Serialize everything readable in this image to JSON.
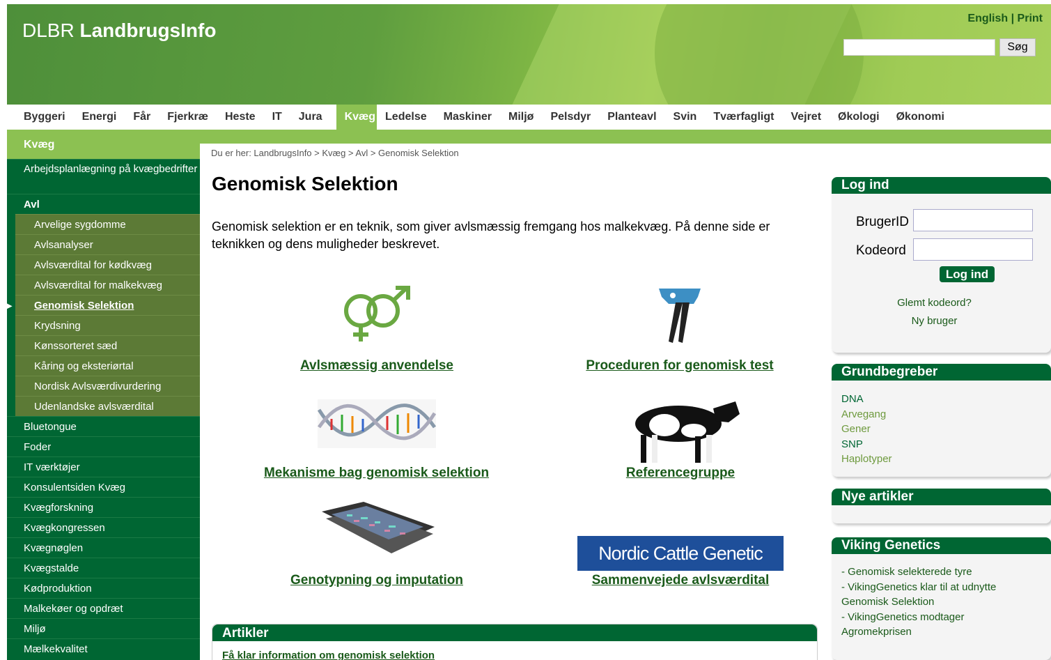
{
  "header": {
    "logo_light": "DLBR ",
    "logo_bold": "LandbrugsInfo",
    "link_english": "English",
    "link_separator": " | ",
    "link_print": "Print",
    "search_placeholder": "",
    "search_button": "Søg"
  },
  "nav": {
    "items": [
      "Byggeri",
      "Energi",
      "Får",
      "Fjerkræ",
      "Heste",
      "IT",
      "Jura",
      "Kvæg",
      "Ledelse",
      "Maskiner",
      "Miljø",
      "Pelsdyr",
      "Planteavl",
      "Svin",
      "Tværfagligt",
      "Vejret",
      "Økologi",
      "Økonomi"
    ],
    "active": "Kvæg"
  },
  "sidebar": {
    "heading": "Kvæg",
    "item_arbejd": "Arbejdsplanlægning på kvægbedrifter",
    "item_avl": "Avl",
    "sub": [
      "Arvelige sygdomme",
      "Avlsanalyser",
      "Avlsværdital for kødkvæg",
      "Avlsværdital for malkekvæg",
      "Genomisk Selektion",
      "Krydsning",
      "Kønssorteret sæd",
      "Kåring og eksteriørtal",
      "Nordisk Avlsværdivurdering",
      "Udenlandske avlsværdital"
    ],
    "items": [
      "Bluetongue",
      "Foder",
      "IT værktøjer",
      "Konsulentsiden Kvæg",
      "Kvægforskning",
      "Kvægkongressen",
      "Kvægnøglen",
      "Kvægstalde",
      "Kødproduktion",
      "Malkekøer og opdræt",
      "Miljø",
      "Mælkekvalitet"
    ]
  },
  "main": {
    "breadcrumb": "Du er her: LandbrugsInfo > Kvæg > Avl > Genomisk Selektion",
    "title": "Genomisk Selektion",
    "intro": "Genomisk selektion er en teknik, som giver avlsmæssig fremgang hos malkekvæg. På denne side er teknikken og dens muligheder beskrevet.",
    "tiles": {
      "t1": "Avlsmæssig anvendelse",
      "t2": "Proceduren for genomisk test ",
      "t3": "Mekanisme bag genomisk selektion",
      "t4": "Referencegruppe",
      "t5": "Genotypning og imputation",
      "t6": "Sammenvejede avlsværdital",
      "ncge_banner": "Nordic Cattle Genetic Evaluation"
    },
    "articles_heading": "Artikler",
    "articles_first": "Få klar information om genomisk selektion"
  },
  "login": {
    "heading": "Log ind",
    "user_label": "BrugerID",
    "pass_label": "Kodeord",
    "button": "Log ind",
    "forgot": "Glemt kodeord?",
    "new_user": "Ny bruger"
  },
  "grund": {
    "heading": "Grundbegreber",
    "items": [
      "DNA",
      "Arvegang",
      "Gener",
      "SNP",
      "Haplotyper"
    ]
  },
  "nye": {
    "heading": "Nye artikler"
  },
  "viking": {
    "heading": "Viking Genetics",
    "lines": [
      "- Genomisk selekterede tyre",
      "- VikingGenetics klar til at udnytte",
      "Genomisk Selektion",
      "- VikingGenetics modtager",
      "Agromekprisen"
    ]
  },
  "colors": {
    "dark_green": "#006633",
    "light_green": "#8cc152",
    "sub_green": "#5c7a36",
    "link_green": "#1a5a1a"
  }
}
